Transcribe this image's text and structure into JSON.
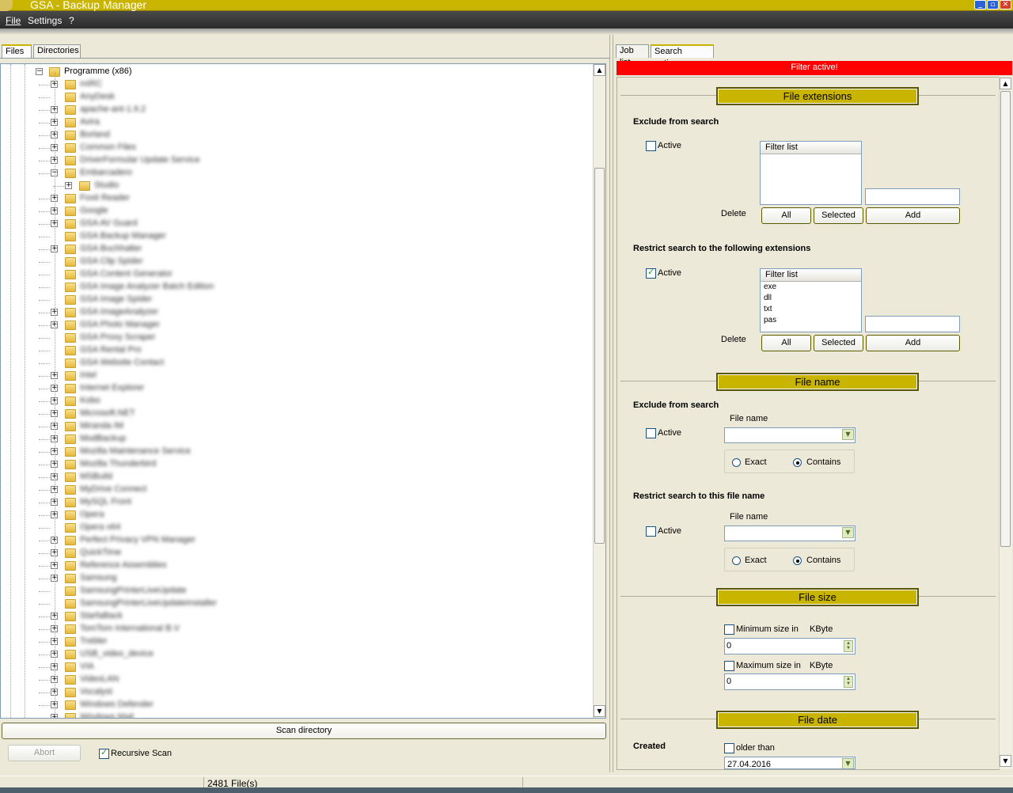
{
  "window": {
    "title": "GSA - Backup Manager"
  },
  "menu": {
    "file": "File",
    "settings": "Settings",
    "help": "?"
  },
  "left_tabs": [
    "Files",
    "Directories"
  ],
  "right_tabs": [
    "Job list",
    "Search options"
  ],
  "tree": {
    "root_label": "Programme (x86)",
    "items": [
      {
        "label": "mIRC",
        "expandable": true
      },
      {
        "label": "AnyDesk",
        "expandable": false
      },
      {
        "label": "apache-ant-1.9.2",
        "expandable": true
      },
      {
        "label": "Avira",
        "expandable": true
      },
      {
        "label": "Borland",
        "expandable": true
      },
      {
        "label": "Common Files",
        "expandable": true
      },
      {
        "label": "DriverFormular Update Service",
        "expandable": true
      },
      {
        "label": "Embarcadero",
        "expandable": true,
        "expanded": true
      },
      {
        "label": "Studio",
        "expandable": true,
        "child": true
      },
      {
        "label": "Foxit Reader",
        "expandable": true
      },
      {
        "label": "Google",
        "expandable": true
      },
      {
        "label": "GSA AV Guard",
        "expandable": true
      },
      {
        "label": "GSA Backup Manager",
        "expandable": false
      },
      {
        "label": "GSA Buchhalter",
        "expandable": true
      },
      {
        "label": "GSA Clip Spider",
        "expandable": false
      },
      {
        "label": "GSA Content Generator",
        "expandable": false
      },
      {
        "label": "GSA Image Analyzer Batch Edition",
        "expandable": false
      },
      {
        "label": "GSA Image Spider",
        "expandable": false
      },
      {
        "label": "GSA ImageAnalyzer",
        "expandable": true
      },
      {
        "label": "GSA Photo Manager",
        "expandable": true
      },
      {
        "label": "GSA Proxy Scraper",
        "expandable": false
      },
      {
        "label": "GSA Rental Pro",
        "expandable": false
      },
      {
        "label": "GSA Website Contact",
        "expandable": false
      },
      {
        "label": "Intel",
        "expandable": true
      },
      {
        "label": "Internet Explorer",
        "expandable": true
      },
      {
        "label": "Kobo",
        "expandable": true
      },
      {
        "label": "Microsoft.NET",
        "expandable": true
      },
      {
        "label": "Miranda IM",
        "expandable": true
      },
      {
        "label": "ModBackup",
        "expandable": true
      },
      {
        "label": "Mozilla Maintenance Service",
        "expandable": true
      },
      {
        "label": "Mozilla Thunderbird",
        "expandable": true
      },
      {
        "label": "MSBuild",
        "expandable": true
      },
      {
        "label": "MyDrive Connect",
        "expandable": true
      },
      {
        "label": "MySQL Front",
        "expandable": true
      },
      {
        "label": "Opera",
        "expandable": true
      },
      {
        "label": "Opera x64",
        "expandable": false
      },
      {
        "label": "Perfect Privacy VPN Manager",
        "expandable": true
      },
      {
        "label": "QuickTime",
        "expandable": true
      },
      {
        "label": "Reference Assemblies",
        "expandable": true
      },
      {
        "label": "Samsung",
        "expandable": true
      },
      {
        "label": "SamsungPrinterLiveUpdate",
        "expandable": false
      },
      {
        "label": "SamsungPrinterLiveUpdateInstaller",
        "expandable": false
      },
      {
        "label": "StarfaBack",
        "expandable": true
      },
      {
        "label": "TomTom International B.V",
        "expandable": true
      },
      {
        "label": "Trebler",
        "expandable": true
      },
      {
        "label": "USB_video_device",
        "expandable": true
      },
      {
        "label": "VIA",
        "expandable": true
      },
      {
        "label": "VideoLAN",
        "expandable": true
      },
      {
        "label": "Vocalyst",
        "expandable": true
      },
      {
        "label": "Windows Defender",
        "expandable": true
      },
      {
        "label": "Windows Mail",
        "expandable": true
      }
    ]
  },
  "left_bottom": {
    "scan": "Scan directory",
    "abort": "Abort",
    "recursive": "Recursive Scan",
    "recursive_checked": true
  },
  "filter_banner": "Filter active!",
  "ext": {
    "title": "File extensions",
    "exclude_title": "Exclude from search",
    "restrict_title": "Restrict search to the following extensions",
    "active": "Active",
    "exclude_active": false,
    "restrict_active": true,
    "filter_list": "Filter list",
    "restrict_items": [
      "exe",
      "dll",
      "txt",
      "pas"
    ],
    "delete": "Delete",
    "all": "All",
    "selected": "Selected",
    "add": "Add"
  },
  "fname": {
    "title": "File name",
    "exclude_title": "Exclude from search",
    "restrict_title": "Restrict search to this file name",
    "active": "Active",
    "label": "File name",
    "exact": "Exact",
    "contains": "Contains"
  },
  "fsize": {
    "title": "File size",
    "min_label": "Minimum size in",
    "max_label": "Maximum size in",
    "unit": "KByte",
    "min_value": "0",
    "max_value": "0"
  },
  "fdate": {
    "title": "File date",
    "created": "Created",
    "older": "older than",
    "date": "27.04.2016"
  },
  "status": {
    "files": "2481 File(s)"
  },
  "colors": {
    "accent": "#c9b400",
    "banner": "#ff0000"
  }
}
